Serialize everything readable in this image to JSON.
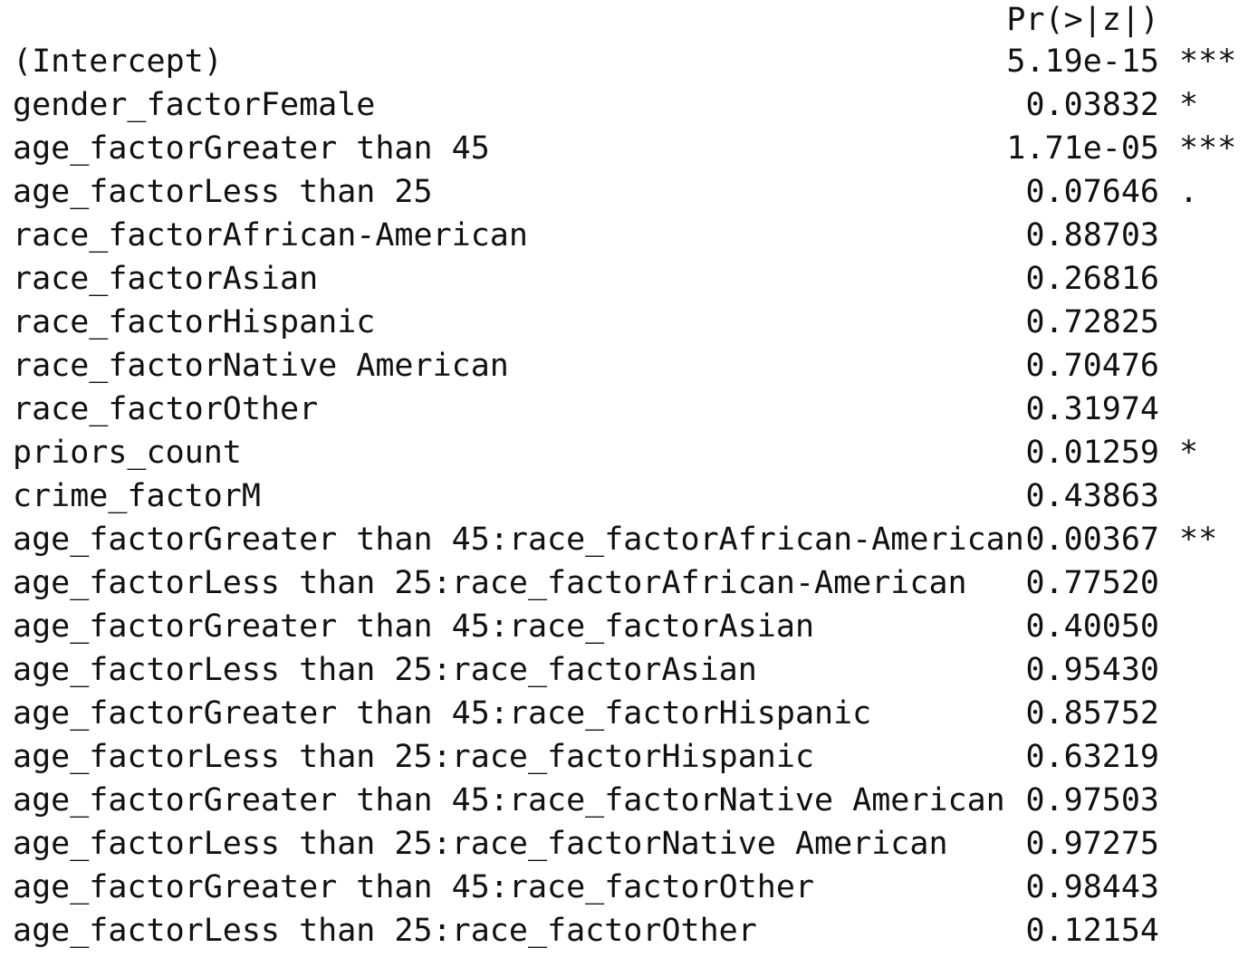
{
  "header": {
    "column_label": "Pr(>|z|)"
  },
  "rows": [
    {
      "term": "(Intercept)",
      "pvalue": "5.19e-15",
      "signif": "***"
    },
    {
      "term": "gender_factorFemale",
      "pvalue": "0.03832",
      "signif": "*"
    },
    {
      "term": "age_factorGreater than 45",
      "pvalue": "1.71e-05",
      "signif": "***"
    },
    {
      "term": "age_factorLess than 25",
      "pvalue": "0.07646",
      "signif": "."
    },
    {
      "term": "race_factorAfrican-American",
      "pvalue": "0.88703",
      "signif": ""
    },
    {
      "term": "race_factorAsian",
      "pvalue": "0.26816",
      "signif": ""
    },
    {
      "term": "race_factorHispanic",
      "pvalue": "0.72825",
      "signif": ""
    },
    {
      "term": "race_factorNative American",
      "pvalue": "0.70476",
      "signif": ""
    },
    {
      "term": "race_factorOther",
      "pvalue": "0.31974",
      "signif": ""
    },
    {
      "term": "priors_count",
      "pvalue": "0.01259",
      "signif": "*"
    },
    {
      "term": "crime_factorM",
      "pvalue": "0.43863",
      "signif": ""
    },
    {
      "term": "age_factorGreater than 45:race_factorAfrican-American",
      "pvalue": "0.00367",
      "signif": "**"
    },
    {
      "term": "age_factorLess than 25:race_factorAfrican-American",
      "pvalue": "0.77520",
      "signif": ""
    },
    {
      "term": "age_factorGreater than 45:race_factorAsian",
      "pvalue": "0.40050",
      "signif": ""
    },
    {
      "term": "age_factorLess than 25:race_factorAsian",
      "pvalue": "0.95430",
      "signif": ""
    },
    {
      "term": "age_factorGreater than 45:race_factorHispanic",
      "pvalue": "0.85752",
      "signif": ""
    },
    {
      "term": "age_factorLess than 25:race_factorHispanic",
      "pvalue": "0.63219",
      "signif": ""
    },
    {
      "term": "age_factorGreater than 45:race_factorNative American",
      "pvalue": "0.97503",
      "signif": ""
    },
    {
      "term": "age_factorLess than 25:race_factorNative American",
      "pvalue": "0.97275",
      "signif": ""
    },
    {
      "term": "age_factorGreater than 45:race_factorOther",
      "pvalue": "0.98443",
      "signif": ""
    },
    {
      "term": "age_factorLess than 25:race_factorOther",
      "pvalue": "0.12154",
      "signif": ""
    }
  ]
}
